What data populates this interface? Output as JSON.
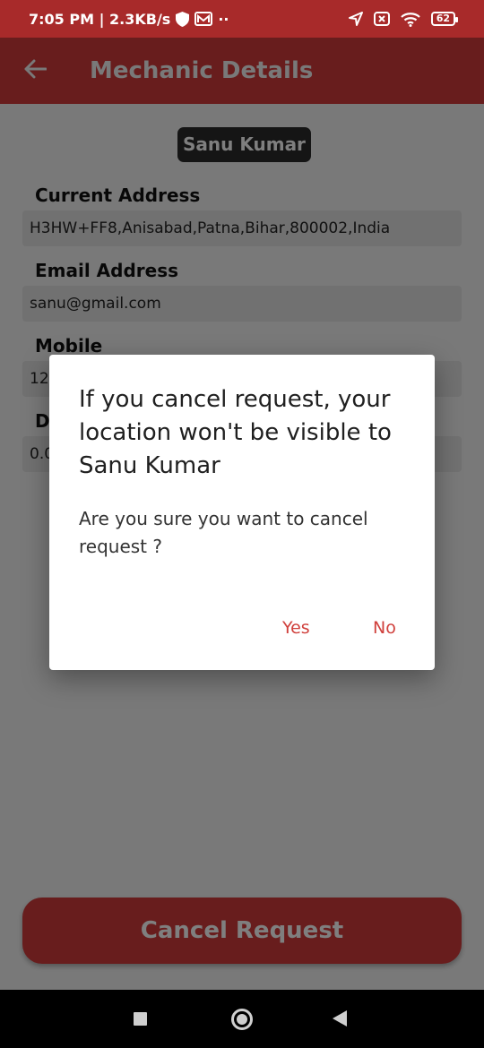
{
  "status_bar": {
    "time_speed": "7:05 PM | 2.3KB/s",
    "battery": "62",
    "icons": [
      "shield-icon",
      "mail-icon",
      "location-arrow-icon",
      "x-box-icon",
      "wifi-icon",
      "battery-icon"
    ]
  },
  "app_bar": {
    "title": "Mechanic Details",
    "back_icon": "arrow-left-icon"
  },
  "mechanic": {
    "name": "Sanu Kumar"
  },
  "fields": [
    {
      "label": "Current Address",
      "value": "H3HW+FF8,Anisabad,Patna,Bihar,800002,India"
    },
    {
      "label": "Email Address",
      "value": "sanu@gmail.com"
    },
    {
      "label": "Mobile",
      "value": "12"
    },
    {
      "label": "D",
      "value": "0.0"
    }
  ],
  "cancel_button": "Cancel Request",
  "dialog": {
    "title": "If you cancel request, your location won't be visible to Sanu Kumar",
    "message": "Are you sure you want to cancel request ?",
    "yes": "Yes",
    "no": "No"
  },
  "colors": {
    "accent": "#d03b3b",
    "status_bar": "#a82a2a",
    "dialog_button": "#d0403c"
  },
  "nav_bar": {
    "icons": [
      "square-recents-icon",
      "circle-home-icon",
      "triangle-back-icon"
    ]
  }
}
